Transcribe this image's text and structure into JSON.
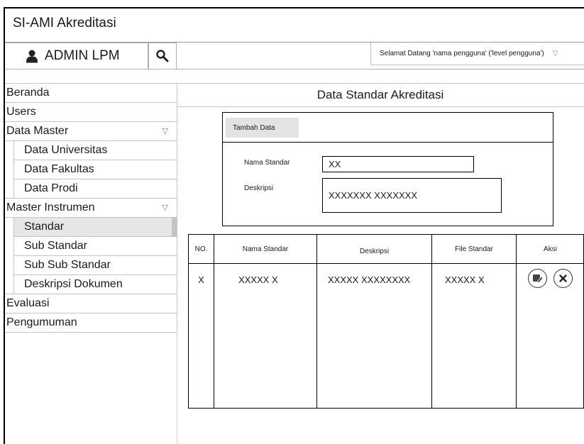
{
  "app": {
    "title": "SI-AMI Akreditasi"
  },
  "header": {
    "user_label": "ADMIN LPM",
    "welcome_text": "Selamat Datang 'nama pengguna' ('level pengguna')"
  },
  "sidebar": {
    "items": [
      {
        "label": "Beranda"
      },
      {
        "label": "Users"
      },
      {
        "label": "Data Master",
        "expanded": true
      },
      {
        "label": "Data Universitas"
      },
      {
        "label": "Data Fakultas"
      },
      {
        "label": "Data Prodi"
      },
      {
        "label": "Master Instrumen",
        "expanded": true
      },
      {
        "label": "Standar",
        "active": true
      },
      {
        "label": "Sub Standar"
      },
      {
        "label": "Sub Sub Standar"
      },
      {
        "label": "Deskripsi Dokumen"
      },
      {
        "label": "Evaluasi"
      },
      {
        "label": "Pengumuman"
      }
    ]
  },
  "main": {
    "title": "Data Standar Akreditasi",
    "form": {
      "add_button": "Tambah Data",
      "name_label": "Nama Standar",
      "name_value": "XX",
      "desc_label": "Deskripsi",
      "desc_value": "XXXXXXX XXXXXXX"
    },
    "table": {
      "columns": [
        "NO.",
        "Nama Standar",
        "Deskripsi",
        "File Standar",
        "Aksi"
      ],
      "rows": [
        {
          "no": "X",
          "nama": "XXXXX X",
          "deskripsi": "XXXXX XXXXXXXX",
          "file": "XXXXX X"
        }
      ]
    }
  },
  "icons": {
    "user": "user-icon",
    "search": "search-icon",
    "dropdown": "chevron-down-icon",
    "edit": "edit-icon",
    "delete": "close-icon"
  }
}
